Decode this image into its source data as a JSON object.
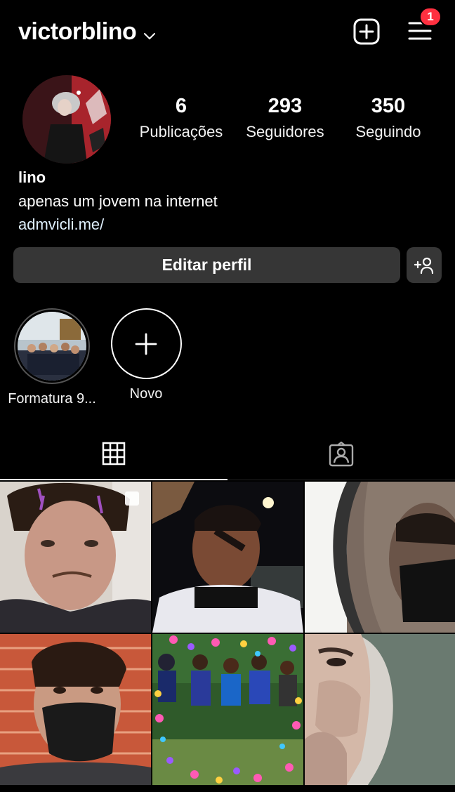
{
  "header": {
    "username": "victorblino",
    "notification_count": "1"
  },
  "profile": {
    "stats": [
      {
        "value": "6",
        "label": "Publicações"
      },
      {
        "value": "293",
        "label": "Seguidores"
      },
      {
        "value": "350",
        "label": "Seguindo"
      }
    ],
    "name": "lino",
    "bio": "apenas um jovem na internet",
    "link": "admvicli.me/"
  },
  "actions": {
    "edit_profile_label": "Editar perfil"
  },
  "highlights": [
    {
      "label": "Formatura 9..."
    },
    {
      "label": "Novo"
    }
  ],
  "tabs": [
    {
      "icon": "grid-icon",
      "active": true
    },
    {
      "icon": "tagged-person-icon",
      "active": false
    }
  ],
  "colors": {
    "background": "#000000",
    "button": "#363636",
    "badge": "#ff3040",
    "link": "#e0f1ff"
  },
  "posts": [
    {
      "description": "selfie with face stickers",
      "multiple": true
    },
    {
      "description": "night selfie with face paint",
      "multiple": false
    },
    {
      "description": "airplane window with masked face",
      "multiple": false
    },
    {
      "description": "selfie with black mask by brick wall",
      "multiple": false
    },
    {
      "description": "group photo with heart stickers",
      "multiple": false
    },
    {
      "description": "selfie with hood",
      "multiple": false
    }
  ]
}
